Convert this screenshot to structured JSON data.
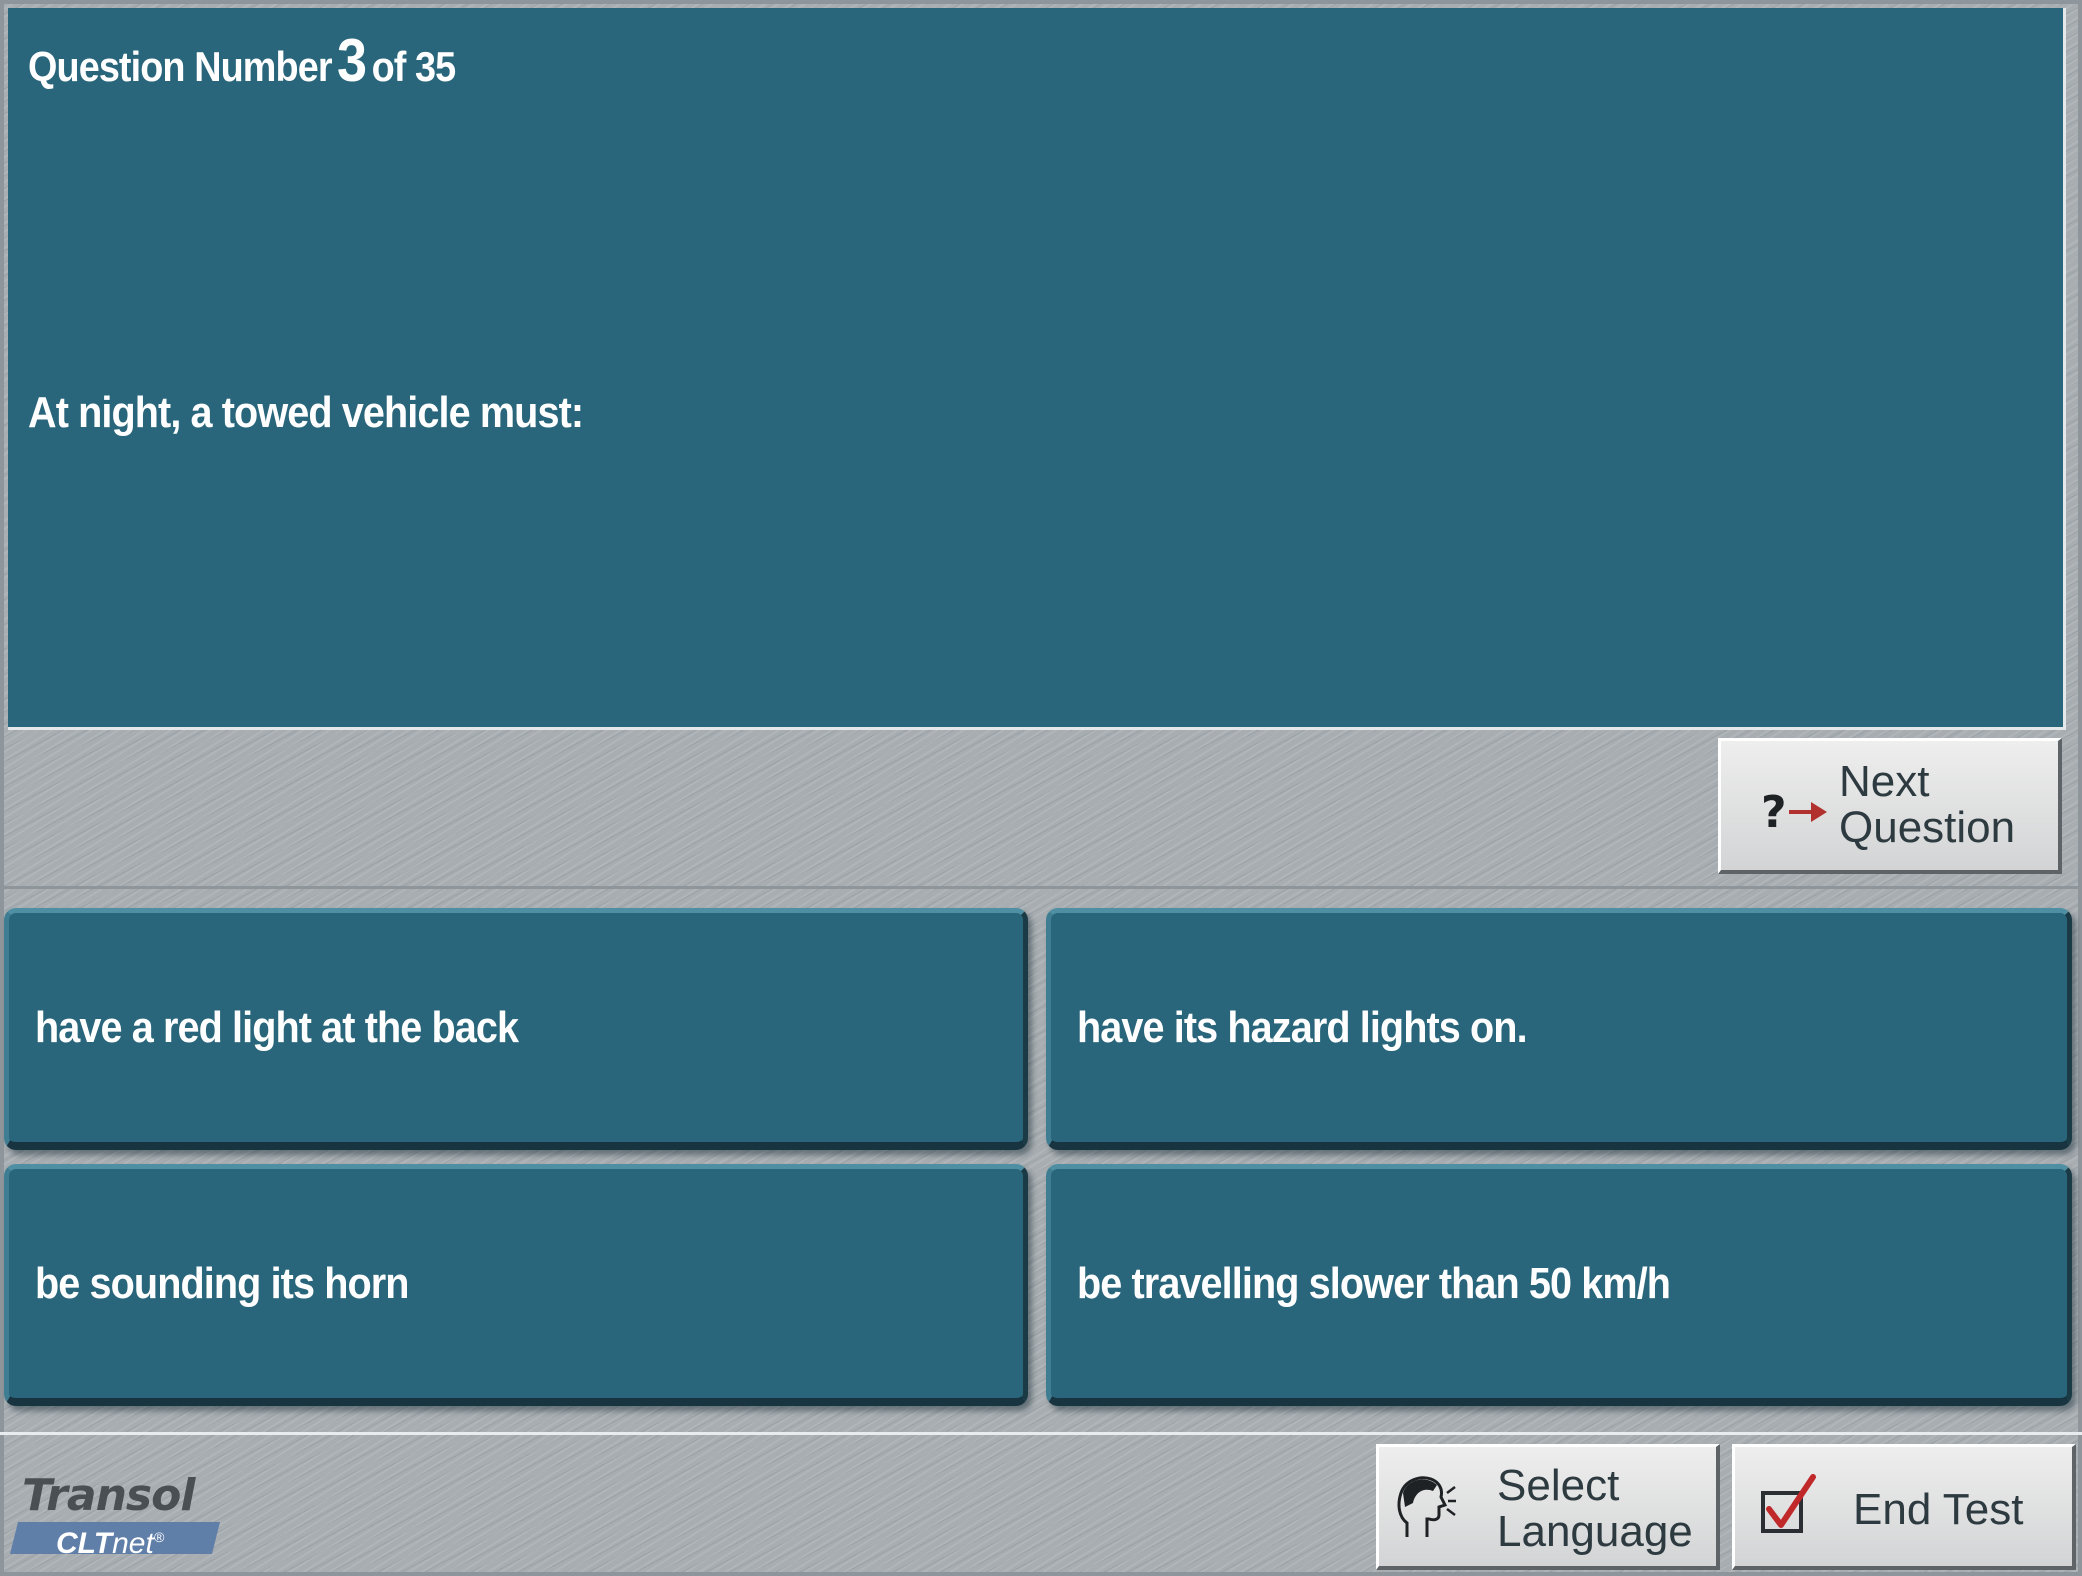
{
  "question": {
    "number_prefix": "Question Number",
    "number": "3",
    "number_suffix": "of 35",
    "text": "At night, a towed vehicle must:"
  },
  "next_button": {
    "line1": "Next",
    "line2": "Question",
    "icon": "question-arrow-icon"
  },
  "answers": [
    {
      "text": "have a red light at the back"
    },
    {
      "text": "have its hazard lights on."
    },
    {
      "text": "be sounding its horn"
    },
    {
      "text": "be travelling slower than 50 km/h"
    }
  ],
  "logo": {
    "brand": "Transol",
    "product_bold": "CLT",
    "product_rest": "net",
    "mark": "®"
  },
  "language_button": {
    "line1": "Select",
    "line2": "Language",
    "icon": "speaking-head-icon"
  },
  "end_button": {
    "label": "End Test",
    "icon": "checkbox-check-icon"
  },
  "colors": {
    "panel": "#2a667b",
    "arrow": "#b0312d",
    "check": "#c0282a"
  }
}
